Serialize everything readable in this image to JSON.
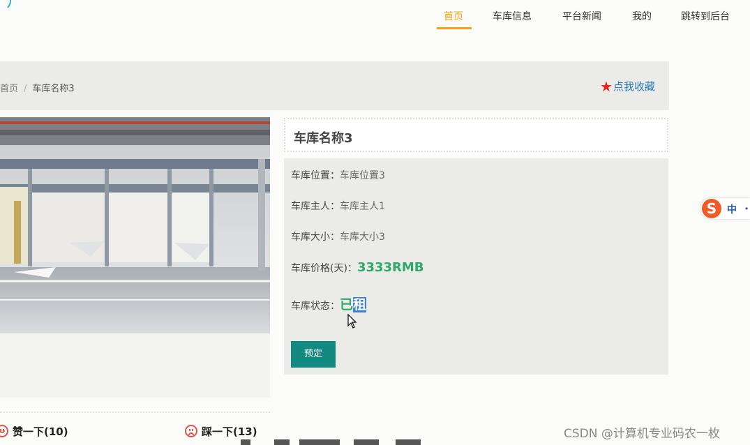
{
  "nav": {
    "items": [
      "首页",
      "车库信息",
      "平台新闻",
      "我的",
      "跳转到后台"
    ],
    "active_index": 0,
    "active_color": "#f2a30f"
  },
  "breadcrumb": {
    "home": "首页",
    "separator": "/",
    "current": "车库名称3"
  },
  "favorite": {
    "icon": "star-icon",
    "label": "点我收藏"
  },
  "garage": {
    "name": "车库名称3",
    "location_label": "车库位置：",
    "location": "车库位置3",
    "owner_label": "车库主人：",
    "owner": "车库主人1",
    "size_label": "车库大小：",
    "size": "车库大小3",
    "price_label": "车库价格(天)：",
    "price": "3333RMB",
    "status_label": "车库状态：",
    "status_part1": "已",
    "status_part2_selected": "租",
    "reserve_button": "预定"
  },
  "votes": {
    "like_label": "赞一下(10)",
    "dislike_label": "踩一下(13)"
  },
  "ime": {
    "logo": "S",
    "lang": "中",
    "dot": "•"
  },
  "watermark": "CSDN @计算机专业码农一枚",
  "colors": {
    "accent": "#f2a30f",
    "price_green": "#2fa86f",
    "button_teal": "#128a82",
    "link_blue": "#2a7ab8",
    "star_red": "#e8211a"
  }
}
